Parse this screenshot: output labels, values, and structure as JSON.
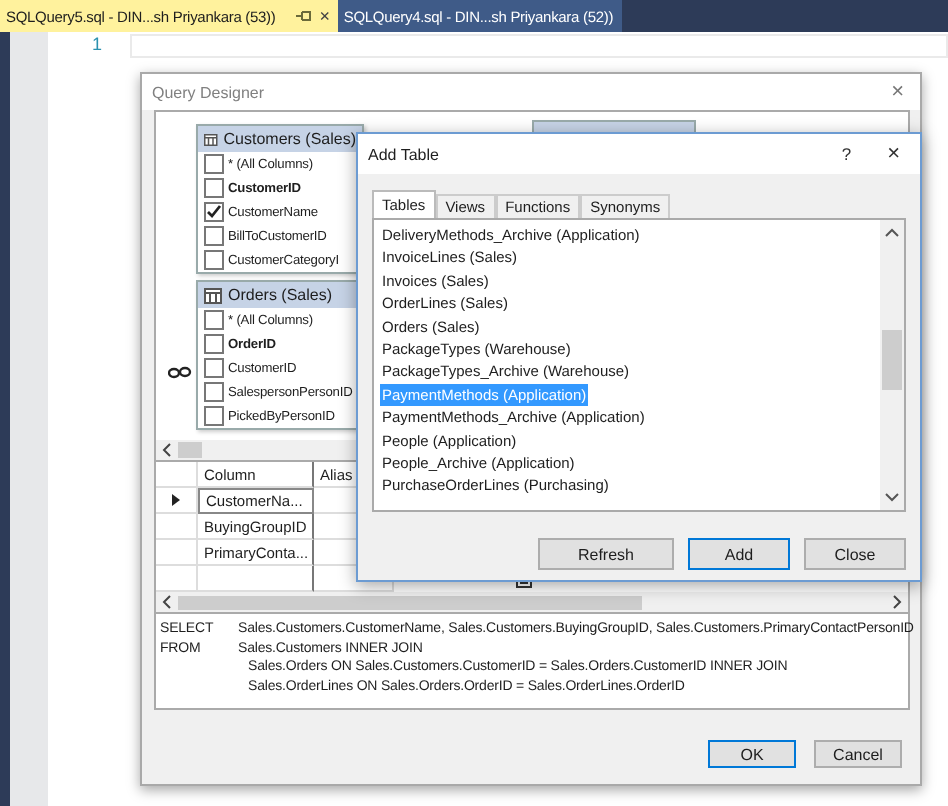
{
  "tabs": [
    {
      "label": "SQLQuery5.sql - DIN...sh Priyankara (53))",
      "selected": true,
      "close": "×"
    },
    {
      "label": "SQLQuery4.sql - DIN...sh Priyankara (52))",
      "selected": false
    }
  ],
  "editor": {
    "line_numbers": [
      "1"
    ]
  },
  "query_designer": {
    "title": "Query Designer",
    "close": "×",
    "diagram_tables": [
      {
        "title": "Customers (Sales)",
        "columns": [
          {
            "name": "* (All Columns)",
            "checked": false,
            "key": false
          },
          {
            "name": "CustomerID",
            "checked": false,
            "key": true
          },
          {
            "name": "CustomerName",
            "checked": true,
            "key": false
          },
          {
            "name": "BillToCustomerID",
            "checked": false,
            "key": false
          },
          {
            "name": "CustomerCategoryI",
            "checked": false,
            "key": false
          }
        ]
      },
      {
        "title": "Orders (Sales)",
        "columns": [
          {
            "name": "* (All Columns)",
            "checked": false,
            "key": false
          },
          {
            "name": "OrderID",
            "checked": false,
            "key": true
          },
          {
            "name": "CustomerID",
            "checked": false,
            "key": false
          },
          {
            "name": "SalespersonPersonID",
            "checked": false,
            "key": false
          },
          {
            "name": "PickedByPersonID",
            "checked": false,
            "key": false
          }
        ]
      }
    ],
    "criteria": {
      "columns": [
        "Column",
        "Alias"
      ],
      "rows": [
        {
          "column": "CustomerNa...",
          "current": true
        },
        {
          "column": "BuyingGroupID",
          "current": false
        },
        {
          "column": "PrimaryConta...",
          "current": false
        }
      ]
    },
    "sql": [
      {
        "keyword": "SELECT",
        "text": "Sales.Customers.CustomerName, Sales.Customers.BuyingGroupID, Sales.Customers.PrimaryContactPersonID",
        "continuation": false
      },
      {
        "keyword": "FROM",
        "text": "Sales.Customers INNER JOIN",
        "continuation": false
      },
      {
        "text": "Sales.Orders ON Sales.Customers.CustomerID = Sales.Orders.CustomerID INNER JOIN",
        "continuation": true
      },
      {
        "text": "Sales.OrderLines ON Sales.Orders.OrderID = Sales.OrderLines.OrderID",
        "continuation": true
      }
    ],
    "buttons": [
      {
        "label": "OK",
        "default": true
      },
      {
        "label": "Cancel",
        "default": false
      }
    ]
  },
  "add_table": {
    "title": "Add Table",
    "help": "?",
    "close": "×",
    "tabs": [
      {
        "label": "Tables",
        "selected": true
      },
      {
        "label": "Views",
        "selected": false
      },
      {
        "label": "Functions",
        "selected": false
      },
      {
        "label": "Synonyms",
        "selected": false
      }
    ],
    "items": [
      {
        "label": "DeliveryMethods_Archive (Application)",
        "selected": false
      },
      {
        "label": "InvoiceLines (Sales)",
        "selected": false
      },
      {
        "label": "Invoices (Sales)",
        "selected": false
      },
      {
        "label": "OrderLines (Sales)",
        "selected": false
      },
      {
        "label": "Orders (Sales)",
        "selected": false
      },
      {
        "label": "PackageTypes (Warehouse)",
        "selected": false
      },
      {
        "label": "PackageTypes_Archive (Warehouse)",
        "selected": false
      },
      {
        "label": "PaymentMethods (Application)",
        "selected": true
      },
      {
        "label": "PaymentMethods_Archive (Application)",
        "selected": false
      },
      {
        "label": "People (Application)",
        "selected": false
      },
      {
        "label": "People_Archive (Application)",
        "selected": false
      },
      {
        "label": "PurchaseOrderLines (Purchasing)",
        "selected": false
      }
    ],
    "buttons": [
      {
        "label": "Refresh",
        "default": false
      },
      {
        "label": "Add",
        "default": true
      },
      {
        "label": "Close",
        "default": false
      }
    ]
  }
}
